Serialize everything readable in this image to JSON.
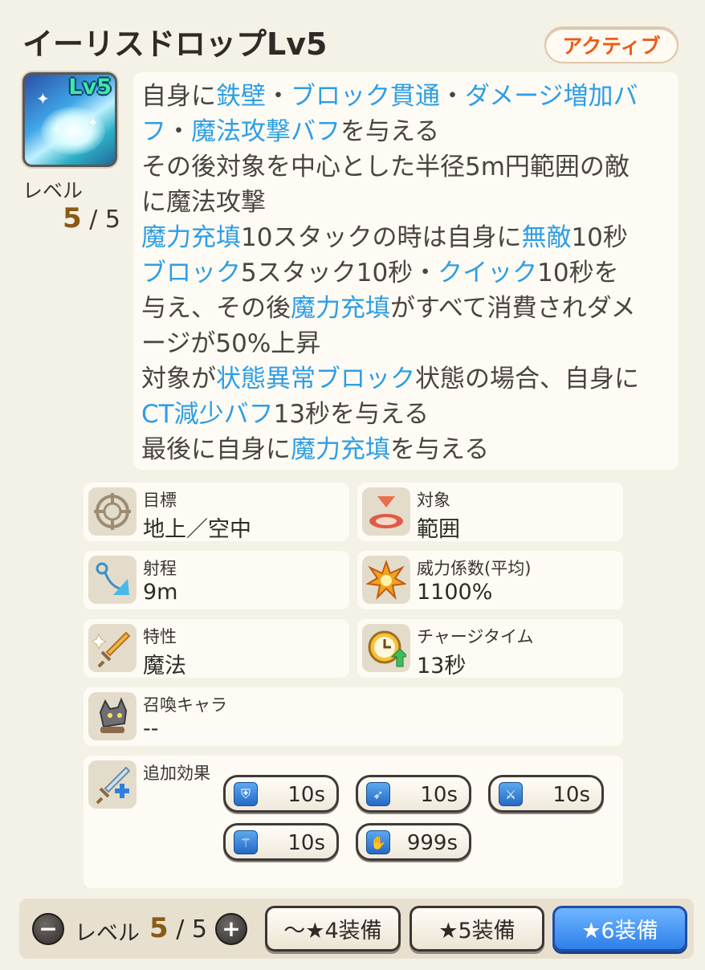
{
  "header": {
    "title": "イーリスドロップLv5",
    "type_badge": "アクティブ"
  },
  "skill_icon": {
    "name": "sparkle-burst-icon",
    "level_badge": "Lv5"
  },
  "level": {
    "label": "レベル",
    "current": "5",
    "max": "/ 5"
  },
  "description": {
    "lines": [
      [
        {
          "t": "自身に"
        },
        {
          "t": "鉄壁",
          "hl": true
        },
        {
          "t": "・"
        },
        {
          "t": "ブロック貫通",
          "hl": true
        },
        {
          "t": "・"
        },
        {
          "t": "ダメージ増加バ",
          "hl": true
        }
      ],
      [
        {
          "t": "フ",
          "hl": true
        },
        {
          "t": "・"
        },
        {
          "t": "魔法攻撃バフ",
          "hl": true
        },
        {
          "t": "を与える"
        }
      ],
      [
        {
          "t": "その後対象を中心とした半径5m円範囲の敵"
        }
      ],
      [
        {
          "t": "に魔法攻撃"
        }
      ],
      [
        {
          "t": "魔力充填",
          "hl": true
        },
        {
          "t": "10スタックの時は自身に"
        },
        {
          "t": "無敵",
          "hl": true
        },
        {
          "t": "10秒"
        }
      ],
      [
        {
          "t": "ブロック",
          "hl": true
        },
        {
          "t": "5スタック10秒・"
        },
        {
          "t": "クイック",
          "hl": true
        },
        {
          "t": "10秒を"
        }
      ],
      [
        {
          "t": "与え、その後"
        },
        {
          "t": "魔力充填",
          "hl": true
        },
        {
          "t": "がすべて消費されダメ"
        }
      ],
      [
        {
          "t": "ージが50%上昇"
        }
      ],
      [
        {
          "t": "対象が"
        },
        {
          "t": "状態異常ブロック",
          "hl": true
        },
        {
          "t": "状態の場合、自身に"
        }
      ],
      [
        {
          "t": "CT減少バフ",
          "hl": true
        },
        {
          "t": "13秒を与える"
        }
      ],
      [
        {
          "t": "最後に自身に"
        },
        {
          "t": "魔力充填",
          "hl": true
        },
        {
          "t": "を与える"
        }
      ]
    ]
  },
  "stats": {
    "target": {
      "label": "目標",
      "value": "地上／空中",
      "icon": "crosshair-icon"
    },
    "area": {
      "label": "対象",
      "value": "範囲",
      "icon": "area-target-icon"
    },
    "range": {
      "label": "射程",
      "value": "9m",
      "icon": "range-arrow-icon"
    },
    "power": {
      "label": "威力係数(平均)",
      "value": "1100%",
      "icon": "explosion-icon"
    },
    "attribute": {
      "label": "特性",
      "value": "魔法",
      "icon": "magic-sword-icon"
    },
    "charge": {
      "label": "チャージタイム",
      "value": "13秒",
      "icon": "clock-up-icon"
    },
    "summon": {
      "label": "召喚キャラ",
      "value": "--",
      "icon": "summon-creature-icon"
    }
  },
  "extra_effects": {
    "label": "追加効果",
    "icon": "sword-plus-icon",
    "items": [
      {
        "icon": "shield-buff-icon",
        "value": "10s"
      },
      {
        "icon": "pierce-buff-icon",
        "value": "10s"
      },
      {
        "icon": "damage-up-buff-icon",
        "value": "10s"
      },
      {
        "icon": "magic-staff-buff-icon",
        "value": "10s"
      },
      {
        "icon": "mana-charge-icon",
        "value": "999s"
      }
    ]
  },
  "footer": {
    "level_label": "レベル",
    "level_current": "5",
    "level_max": "/ 5",
    "minus": "−",
    "plus": "+",
    "equip_buttons": [
      "～★4装備",
      "★5装備",
      "★6装備"
    ],
    "active_index": 2
  },
  "colors": {
    "background": "#f4f1e6",
    "highlight_text": "#2d9ee6",
    "badge_text": "#ef5a15",
    "level_accent": "#8a5a16",
    "active_button": "#2f7fe9"
  }
}
